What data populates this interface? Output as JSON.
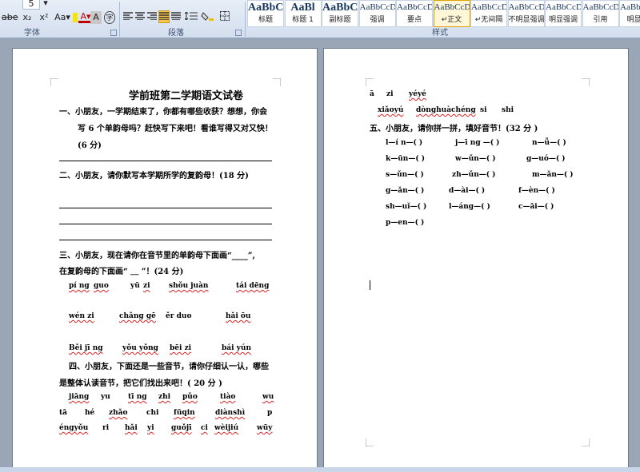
{
  "toolbar": {
    "font_group_label": "字体",
    "paragraph_group_label": "段落",
    "styles_group_label": "样式",
    "row1_fragments": [
      "5",
      "A"
    ],
    "font_tools": [
      "abe",
      "x₂",
      "x²",
      "Aa▾",
      "A▾",
      "A",
      "A",
      "字"
    ],
    "styles": [
      {
        "preview": "AaBbC",
        "name": "标题"
      },
      {
        "preview": "AaBl",
        "name": "标题 1"
      },
      {
        "preview": "AaBbC",
        "name": "副标题"
      },
      {
        "preview": "AaBbCcDi",
        "name": "强调"
      },
      {
        "preview": "AaBbCcDi",
        "name": "要点"
      },
      {
        "preview": "AaBbCcDi",
        "name": "↵正文",
        "active": true
      },
      {
        "preview": "AaBbCcDi",
        "name": "↵无间隔"
      },
      {
        "preview": "AaBbCcDi",
        "name": "不明显强调"
      },
      {
        "preview": "AaBbCcDi",
        "name": "明显强调"
      },
      {
        "preview": "AaBbCcDi",
        "name": "引用"
      },
      {
        "preview": "AaBbCcDi",
        "name": "明显引"
      }
    ]
  },
  "page1": {
    "title": "学前班第二学期语文试卷",
    "q1_line1": "一、小朋友，一学期结束了，你都有哪些收获？想想，你会",
    "q1_line2": "写 6 个单韵母吗？赶快写下来吧！看谁写得又对又快！",
    "q1_line3": "(6 分)",
    "q2": "二、小朋友，请你默写本学期所学的复韵母！(18 分)",
    "q3_line1": "三、小朋友，现在请你在音节里的单韵母下面画“____”,",
    "q3_line2": "在复韵母的下面画“ ＿    ”！(24 分)",
    "q3_row1": [
      "pí ng",
      "guo",
      "yū",
      "zi",
      "shǒu juàn",
      "tái dēng"
    ],
    "q3_row2": [
      "wén zi",
      "chǎng gē",
      "ěr duo",
      "hǎi ōu"
    ],
    "q3_row3": [
      "Běi jī ng",
      "yǒu yǒng",
      "bēi zi",
      "bái yún"
    ],
    "q4_line1": "四、小朋友，下面还是一些音节，请你仔细认一认，哪些",
    "q4_line2": "是整体认读音节，把它们找出来吧！( 20 分 )",
    "q4_row1": [
      "jiāng",
      "yu",
      "tī ng",
      "zhi",
      "pǔo",
      "tiào",
      "wu"
    ],
    "q4_row2": [
      "tā",
      "hé",
      "zhǎo",
      "chi",
      "fūqin",
      "diànshì",
      "p"
    ],
    "q4_row3": [
      "éngyǒu",
      "ri",
      "hǎi",
      "yi",
      "guǒjī",
      "ci",
      "wèijiú",
      "wūy"
    ]
  },
  "page2": {
    "top_row1": [
      "ā",
      "zi",
      "yéyé"
    ],
    "top_row2": [
      "xiǎoyú",
      "dònghuàchéng",
      "si",
      "shi"
    ],
    "q5": "五、小朋友，请你拼一拼，填好音节！(32 分 )",
    "q5_rows": [
      [
        "l—í n—(    )",
        "j—ī ng —(    )",
        "n—ǚ—(    )"
      ],
      [
        "k—ūn—(    )",
        "w—ǔn—(    )",
        "g—uó—(    )"
      ],
      [
        "s—ǔn—(    )",
        "zh—ǔn—(    )",
        "m—ǎn—(    )"
      ],
      [
        "g—ǎn—(    )",
        "d—ài—(    )",
        "f—èn—(    )"
      ],
      [
        "sh—uǐ—(    )",
        "l—áng—(    )",
        "c—āi—(    )"
      ],
      [
        "p—en—(    )"
      ]
    ]
  }
}
